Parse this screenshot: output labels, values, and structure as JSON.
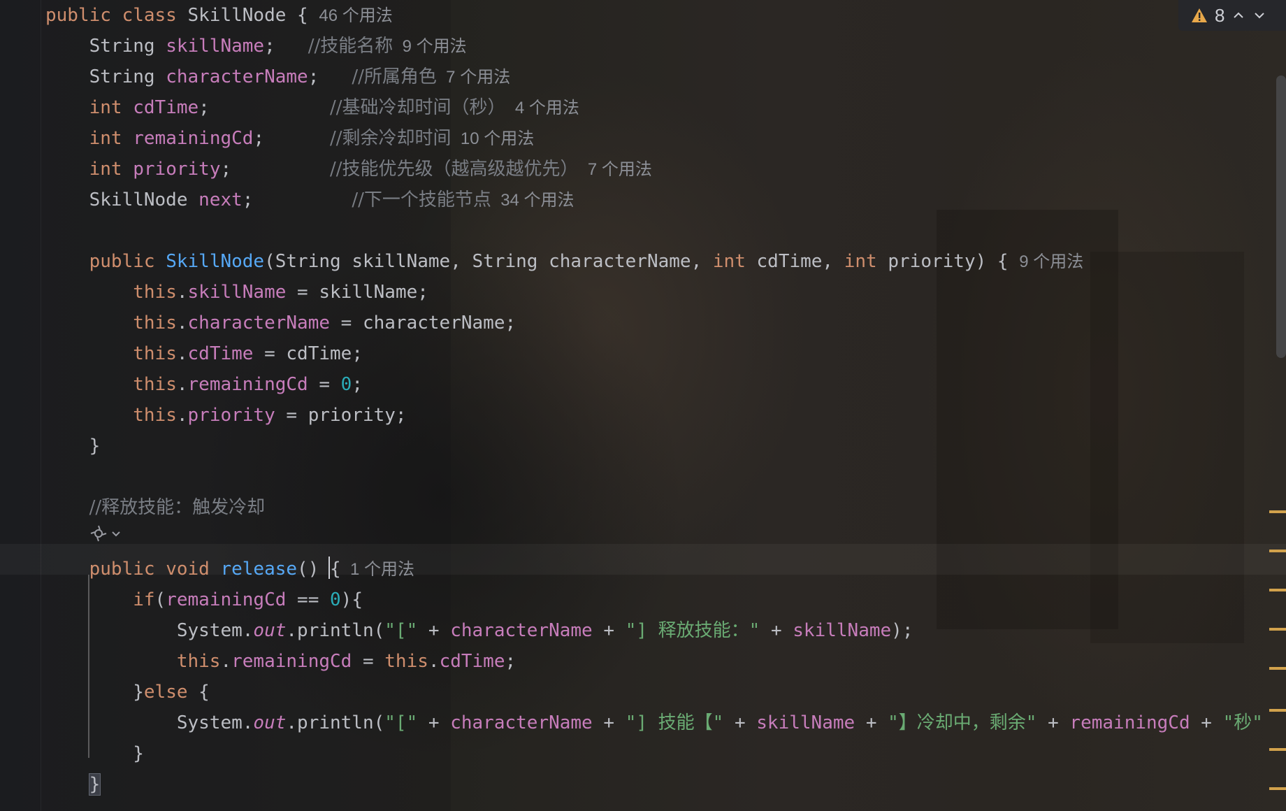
{
  "editor": {
    "lines": [
      {
        "id": "class-decl",
        "segments": [
          {
            "t": "public class",
            "c": "kw"
          },
          {
            "t": " SkillNode { ",
            "c": "plain"
          },
          {
            "t": "46 个用法",
            "c": "usage"
          }
        ]
      },
      {
        "id": "field-skillname",
        "segments": [
          {
            "t": "    String ",
            "c": "plain"
          },
          {
            "t": "skillName",
            "c": "fld"
          },
          {
            "t": ";   ",
            "c": "plain"
          },
          {
            "t": "//技能名称",
            "c": "cmt"
          },
          {
            "t": "  9 个用法",
            "c": "usage"
          }
        ]
      },
      {
        "id": "field-charactername",
        "segments": [
          {
            "t": "    String ",
            "c": "plain"
          },
          {
            "t": "characterName",
            "c": "fld"
          },
          {
            "t": ";   ",
            "c": "plain"
          },
          {
            "t": "//所属角色",
            "c": "cmt"
          },
          {
            "t": "  7 个用法",
            "c": "usage"
          }
        ]
      },
      {
        "id": "field-cdtime",
        "segments": [
          {
            "t": "    ",
            "c": "plain"
          },
          {
            "t": "int",
            "c": "kw"
          },
          {
            "t": " ",
            "c": "plain"
          },
          {
            "t": "cdTime",
            "c": "fld"
          },
          {
            "t": ";           ",
            "c": "plain"
          },
          {
            "t": "//基础冷却时间（秒）",
            "c": "cmt"
          },
          {
            "t": "  4 个用法",
            "c": "usage"
          }
        ]
      },
      {
        "id": "field-remainingcd",
        "segments": [
          {
            "t": "    ",
            "c": "plain"
          },
          {
            "t": "int",
            "c": "kw"
          },
          {
            "t": " ",
            "c": "plain"
          },
          {
            "t": "remainingCd",
            "c": "fld"
          },
          {
            "t": ";      ",
            "c": "plain"
          },
          {
            "t": "//剩余冷却时间",
            "c": "cmt"
          },
          {
            "t": "  10 个用法",
            "c": "usage"
          }
        ]
      },
      {
        "id": "field-priority",
        "segments": [
          {
            "t": "    ",
            "c": "plain"
          },
          {
            "t": "int",
            "c": "kw"
          },
          {
            "t": " ",
            "c": "plain"
          },
          {
            "t": "priority",
            "c": "fld"
          },
          {
            "t": ";         ",
            "c": "plain"
          },
          {
            "t": "//技能优先级（越高级越优先）",
            "c": "cmt"
          },
          {
            "t": "  7 个用法",
            "c": "usage"
          }
        ]
      },
      {
        "id": "field-next",
        "segments": [
          {
            "t": "    SkillNode ",
            "c": "plain"
          },
          {
            "t": "next",
            "c": "fld"
          },
          {
            "t": ";         ",
            "c": "plain"
          },
          {
            "t": "//下一个技能节点",
            "c": "cmt"
          },
          {
            "t": "  34 个用法",
            "c": "usage"
          }
        ]
      },
      {
        "id": "blank-1",
        "segments": []
      },
      {
        "id": "ctor-decl",
        "segments": [
          {
            "t": "    ",
            "c": "plain"
          },
          {
            "t": "public",
            "c": "kw"
          },
          {
            "t": " ",
            "c": "plain"
          },
          {
            "t": "SkillNode",
            "c": "fn"
          },
          {
            "t": "(String skillName, String characterName, ",
            "c": "plain"
          },
          {
            "t": "int",
            "c": "kw"
          },
          {
            "t": " cdTime, ",
            "c": "plain"
          },
          {
            "t": "int",
            "c": "kw"
          },
          {
            "t": " priority) { ",
            "c": "plain"
          },
          {
            "t": "9 个用法",
            "c": "usage"
          }
        ]
      },
      {
        "id": "ctor-skillname",
        "segments": [
          {
            "t": "        ",
            "c": "plain"
          },
          {
            "t": "this",
            "c": "kw"
          },
          {
            "t": ".",
            "c": "plain"
          },
          {
            "t": "skillName",
            "c": "fld"
          },
          {
            "t": " = skillName;",
            "c": "plain"
          }
        ]
      },
      {
        "id": "ctor-charactername",
        "segments": [
          {
            "t": "        ",
            "c": "plain"
          },
          {
            "t": "this",
            "c": "kw"
          },
          {
            "t": ".",
            "c": "plain"
          },
          {
            "t": "characterName",
            "c": "fld"
          },
          {
            "t": " = characterName;",
            "c": "plain"
          }
        ]
      },
      {
        "id": "ctor-cdtime",
        "segments": [
          {
            "t": "        ",
            "c": "plain"
          },
          {
            "t": "this",
            "c": "kw"
          },
          {
            "t": ".",
            "c": "plain"
          },
          {
            "t": "cdTime",
            "c": "fld"
          },
          {
            "t": " = cdTime;",
            "c": "plain"
          }
        ]
      },
      {
        "id": "ctor-remainingcd",
        "segments": [
          {
            "t": "        ",
            "c": "plain"
          },
          {
            "t": "this",
            "c": "kw"
          },
          {
            "t": ".",
            "c": "plain"
          },
          {
            "t": "remainingCd",
            "c": "fld"
          },
          {
            "t": " = ",
            "c": "plain"
          },
          {
            "t": "0",
            "c": "num"
          },
          {
            "t": ";",
            "c": "plain"
          }
        ]
      },
      {
        "id": "ctor-priority",
        "segments": [
          {
            "t": "        ",
            "c": "plain"
          },
          {
            "t": "this",
            "c": "kw"
          },
          {
            "t": ".",
            "c": "plain"
          },
          {
            "t": "priority",
            "c": "fld"
          },
          {
            "t": " = priority;",
            "c": "plain"
          }
        ]
      },
      {
        "id": "ctor-close",
        "segments": [
          {
            "t": "    }",
            "c": "plain"
          }
        ]
      },
      {
        "id": "blank-2",
        "segments": []
      },
      {
        "id": "release-comment",
        "segments": [
          {
            "t": "    ",
            "c": "plain"
          },
          {
            "t": "//释放技能：触发冷却",
            "c": "cmt"
          }
        ]
      },
      {
        "id": "ai-hint-row",
        "segments": []
      },
      {
        "id": "release-decl",
        "segments": [
          {
            "t": "    ",
            "c": "plain"
          },
          {
            "t": "public void",
            "c": "kw"
          },
          {
            "t": " ",
            "c": "plain"
          },
          {
            "t": "release",
            "c": "fn"
          },
          {
            "t": "() ",
            "c": "plain"
          },
          {
            "t": "{",
            "c": "plain",
            "caret": true
          },
          {
            "t": "  1 个用法",
            "c": "usage"
          }
        ]
      },
      {
        "id": "release-if",
        "segments": [
          {
            "t": "        ",
            "c": "plain"
          },
          {
            "t": "if",
            "c": "kw"
          },
          {
            "t": "(",
            "c": "plain"
          },
          {
            "t": "remainingCd",
            "c": "fld"
          },
          {
            "t": " == ",
            "c": "plain"
          },
          {
            "t": "0",
            "c": "num"
          },
          {
            "t": "){",
            "c": "plain"
          }
        ]
      },
      {
        "id": "release-println-1",
        "segments": [
          {
            "t": "            System.",
            "c": "plain"
          },
          {
            "t": "out",
            "c": "st"
          },
          {
            "t": ".println(",
            "c": "plain"
          },
          {
            "t": "\"[\"",
            "c": "str"
          },
          {
            "t": " + ",
            "c": "plain"
          },
          {
            "t": "characterName",
            "c": "fld"
          },
          {
            "t": " + ",
            "c": "plain"
          },
          {
            "t": "\"] 释放技能：\"",
            "c": "str"
          },
          {
            "t": " + ",
            "c": "plain"
          },
          {
            "t": "skillName",
            "c": "fld"
          },
          {
            "t": ");",
            "c": "plain"
          }
        ]
      },
      {
        "id": "release-assign",
        "segments": [
          {
            "t": "            ",
            "c": "plain"
          },
          {
            "t": "this",
            "c": "kw"
          },
          {
            "t": ".",
            "c": "plain"
          },
          {
            "t": "remainingCd",
            "c": "fld"
          },
          {
            "t": " = ",
            "c": "plain"
          },
          {
            "t": "this",
            "c": "kw"
          },
          {
            "t": ".",
            "c": "plain"
          },
          {
            "t": "cdTime",
            "c": "fld"
          },
          {
            "t": ";",
            "c": "plain"
          }
        ]
      },
      {
        "id": "release-else",
        "segments": [
          {
            "t": "        }",
            "c": "plain"
          },
          {
            "t": "else",
            "c": "kw"
          },
          {
            "t": " {",
            "c": "plain"
          }
        ]
      },
      {
        "id": "release-println-2",
        "segments": [
          {
            "t": "            System.",
            "c": "plain"
          },
          {
            "t": "out",
            "c": "st"
          },
          {
            "t": ".println(",
            "c": "plain"
          },
          {
            "t": "\"[\"",
            "c": "str"
          },
          {
            "t": " + ",
            "c": "plain"
          },
          {
            "t": "characterName",
            "c": "fld"
          },
          {
            "t": " + ",
            "c": "plain"
          },
          {
            "t": "\"] 技能【\"",
            "c": "str"
          },
          {
            "t": " + ",
            "c": "plain"
          },
          {
            "t": "skillName",
            "c": "fld"
          },
          {
            "t": " + ",
            "c": "plain"
          },
          {
            "t": "\"】冷却中，剩余\"",
            "c": "str"
          },
          {
            "t": " + ",
            "c": "plain"
          },
          {
            "t": "remainingCd",
            "c": "fld"
          },
          {
            "t": " + ",
            "c": "plain"
          },
          {
            "t": "\"秒\"",
            "c": "str"
          }
        ]
      },
      {
        "id": "release-if-close",
        "segments": [
          {
            "t": "        }",
            "c": "plain"
          }
        ]
      },
      {
        "id": "release-close",
        "segments": [
          {
            "t": "    ",
            "c": "plain"
          },
          {
            "t": "}",
            "c": "plain",
            "match": true
          }
        ]
      }
    ]
  },
  "inspection": {
    "warning_count": "8"
  },
  "icons": {
    "warning": "warning-triangle-icon",
    "ai_hint": "ai-assistant-icon",
    "prev": "chevron-up-icon",
    "next": "chevron-down-icon"
  },
  "colors": {
    "keyword": "#cf8e6d",
    "field": "#c77dbb",
    "method": "#56a8f5",
    "number": "#2aacb8",
    "string": "#6aab73",
    "comment": "#7a7e85",
    "usage": "#8c8f96",
    "plain": "#bcbec4",
    "warning": "#e8a84a",
    "marker": "#d2a24c"
  }
}
